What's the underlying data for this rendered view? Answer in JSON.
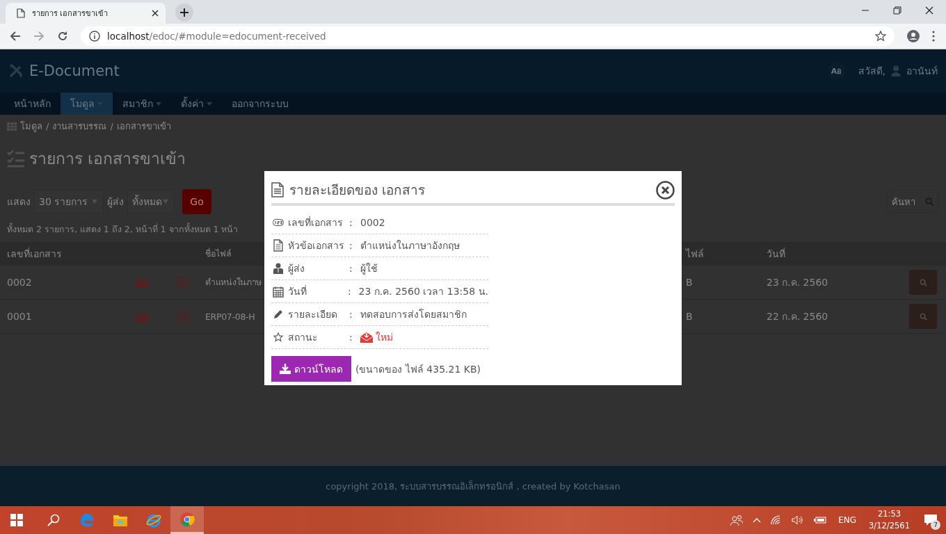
{
  "browser": {
    "tab_title": "รายการ เอกสารขาเข้า",
    "address_host": "localhost",
    "address_path": "/edoc/#module=edocument-received"
  },
  "header": {
    "brand": "E-Document",
    "lang_button": "Aอ",
    "greeting": "สวัสดี,",
    "user": "อานันท์"
  },
  "nav": [
    {
      "label": "หน้าหลัก",
      "dropdown": false,
      "selected": false
    },
    {
      "label": "โมดูล",
      "dropdown": true,
      "selected": true
    },
    {
      "label": "สมาชิก",
      "dropdown": true,
      "selected": false
    },
    {
      "label": "ตั้งค่า",
      "dropdown": true,
      "selected": false
    },
    {
      "label": "ออกจากระบบ",
      "dropdown": false,
      "selected": false
    }
  ],
  "breadcrumb": {
    "separator": "/",
    "items": [
      "โมดูล",
      "งานสารบรรณ",
      "เอกสารขาเข้า"
    ]
  },
  "page_title": "รายการ เอกสารขาเข้า",
  "filters": {
    "show_label": "แสดง",
    "show_value": "30 รายการ",
    "sender_label": "ผู้ส่ง",
    "sender_value": "ทั้งหมด",
    "go": "Go",
    "search_placeholder": "ค้นหา"
  },
  "summary": "ทั้งหมด 2 รายการ, แสดง 1 ถึง 2, หน้าที่ 1 จากทั้งหมด 1 หน้า",
  "table": {
    "columns": [
      "เลขที่เอกสาร",
      "ชื่อไฟล์",
      "ไฟล์",
      "วันที่"
    ],
    "rows": [
      {
        "number": "0002",
        "file_name": "ตำแหน่งในภาษ",
        "size": "B",
        "date": "23 ก.ค. 2560"
      },
      {
        "number": "0001",
        "file_name": "ERP07-08-H",
        "size": "B",
        "date": "22 ก.ค. 2560"
      }
    ]
  },
  "modal": {
    "title": "รายละเอียดของ เอกสาร",
    "separator": ":",
    "fields": [
      {
        "label": "เลขที่เอกสาร",
        "value": "0002",
        "kind": "text"
      },
      {
        "label": "หัวข้อเอกสาร",
        "value": "ตำแหน่งในภาษาอังกฤษ",
        "kind": "text"
      },
      {
        "label": "ผู้ส่ง",
        "value": "ผู้ใช้",
        "kind": "text"
      },
      {
        "label": "วันที่",
        "value": "23 ก.ค. 2560 เวลา 13:58 น.",
        "kind": "text"
      },
      {
        "label": "รายละเอียด",
        "value": "ทดสอบการส่งโดยสมาชิก",
        "kind": "text"
      },
      {
        "label": "สถานะ",
        "value": "ใหม่",
        "kind": "status"
      }
    ],
    "download": "ดาวน์โหลด",
    "file_size_note": "(ขนาดของ ไฟล์ 435.21 KB)"
  },
  "footer": "copyright 2018, ระบบสารบรรณอิเล็กทรอนิกส์ , created by Kotchasan",
  "taskbar": {
    "apps": [
      {
        "kind": "edge",
        "selected": false
      },
      {
        "kind": "explorer",
        "selected": false
      },
      {
        "kind": "ie",
        "selected": false
      },
      {
        "kind": "chrome",
        "selected": true
      }
    ],
    "language": "ENG",
    "time": "21:53",
    "date": "3/12/2561",
    "notifications": "7"
  }
}
